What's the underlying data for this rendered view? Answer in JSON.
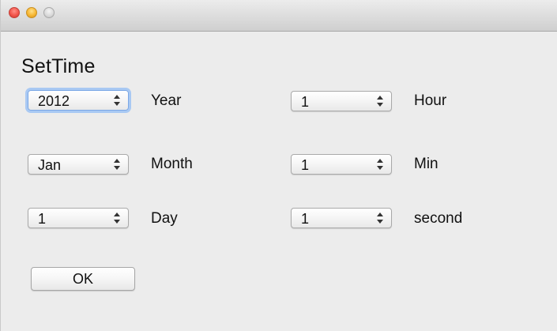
{
  "window": {
    "controls": {
      "close": "close",
      "minimize": "minimize",
      "zoom": "zoom"
    }
  },
  "panel": {
    "title": "SetTime"
  },
  "fields": {
    "year": {
      "value": "2012",
      "label": "Year"
    },
    "month": {
      "value": "Jan",
      "label": "Month"
    },
    "day": {
      "value": "1",
      "label": "Day"
    },
    "hour": {
      "value": "1",
      "label": "Hour"
    },
    "min": {
      "value": "1",
      "label": "Min"
    },
    "second": {
      "value": "1",
      "label": "second"
    }
  },
  "ok_button": {
    "label": "OK"
  },
  "colors": {
    "window_background": "#ececec",
    "focus_ring": "#a9c9f3",
    "close": "#f2544a",
    "minimize": "#f7b733"
  }
}
